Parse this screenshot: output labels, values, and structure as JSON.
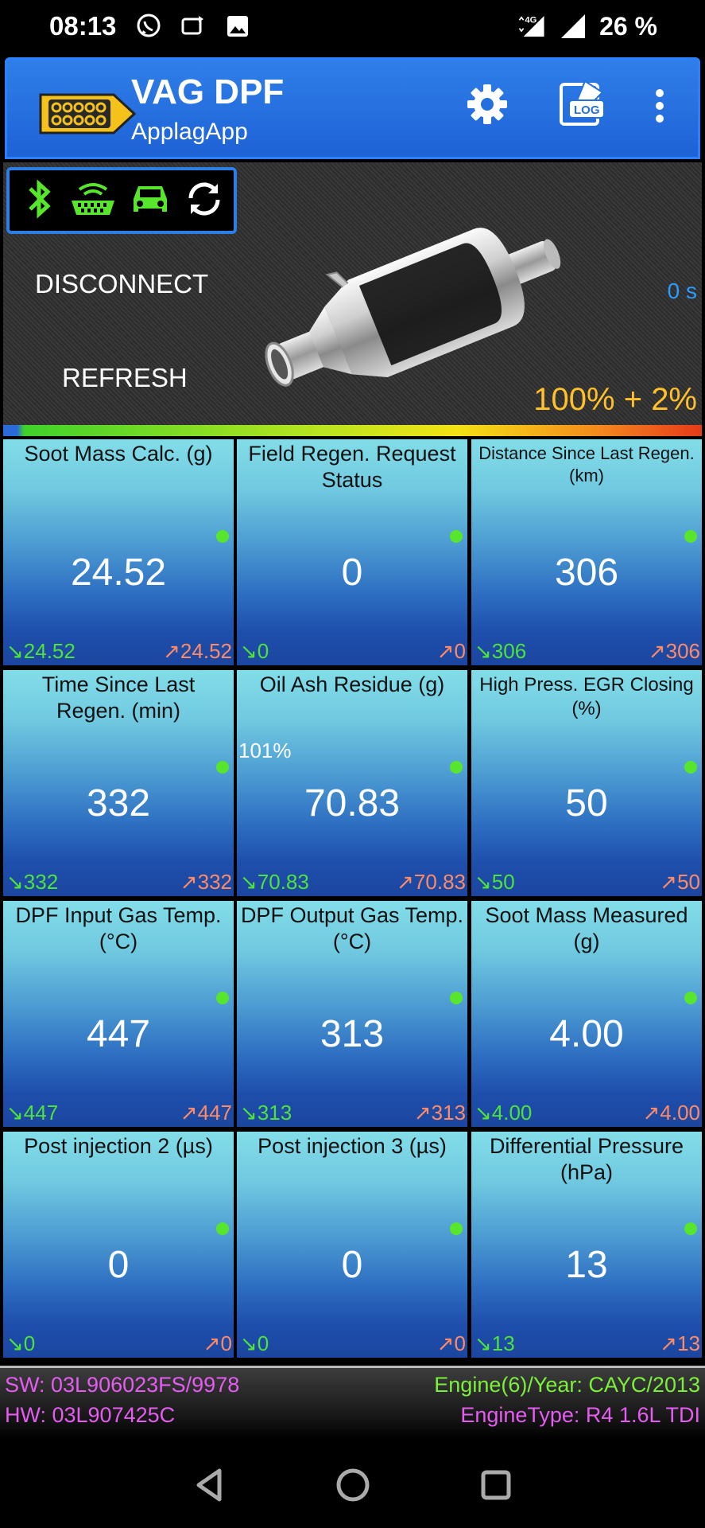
{
  "status_bar": {
    "time": "08:13",
    "network": "4G",
    "battery": "26 %"
  },
  "app_bar": {
    "title": "VAG DPF",
    "subtitle": "ApplagApp"
  },
  "hero": {
    "disconnect_label": "DISCONNECT",
    "refresh_label": "REFRESH",
    "timer": "0 s",
    "fill": "100% + 2%"
  },
  "tiles": [
    {
      "title": "Soot Mass Calc. (g)",
      "value": "24.52",
      "min": "↘24.52",
      "max": "↗24.52"
    },
    {
      "title": "Field Regen. Request Status",
      "value": "0",
      "min": "↘0",
      "max": "↗0"
    },
    {
      "title": "Distance Since Last Regen. (km)",
      "value": "306",
      "min": "↘306",
      "max": "↗306"
    },
    {
      "title": "Time Since Last Regen. (min)",
      "value": "332",
      "min": "↘332",
      "max": "↗332"
    },
    {
      "title": "Oil Ash Residue (g)",
      "value": "70.83",
      "min": "↘70.83",
      "max": "↗70.83",
      "percent": "101%"
    },
    {
      "title": "High Press. EGR Closing (%)",
      "value": "50",
      "min": "↘50",
      "max": "↗50"
    },
    {
      "title": "DPF Input Gas Temp. (°C)",
      "value": "447",
      "min": "↘447",
      "max": "↗447"
    },
    {
      "title": "DPF Output Gas Temp. (°C)",
      "value": "313",
      "min": "↘313",
      "max": "↗313"
    },
    {
      "title": "Soot Mass Measured (g)",
      "value": "4.00",
      "min": "↘4.00",
      "max": "↗4.00"
    },
    {
      "title": "Post injection 2 (µs)",
      "value": "0",
      "min": "↘0",
      "max": "↗0"
    },
    {
      "title": "Post injection 3 (µs)",
      "value": "0",
      "min": "↘0",
      "max": "↗0"
    },
    {
      "title": "Differential Pressure (hPa)",
      "value": "13",
      "min": "↘13",
      "max": "↗13"
    }
  ],
  "info": {
    "sw": "SW: 03L906023FS/9978",
    "hw": "HW: 03L907425C",
    "engine": "Engine(6)/Year: CAYC/2013",
    "engine_type": "EngineType: R4 1.6L TDI"
  },
  "colors": {
    "accent": "#2a80ff",
    "status_ok": "#57e62b",
    "min": "#4ee23a",
    "max": "#ff8a66",
    "fill_text": "#ffc02a"
  }
}
